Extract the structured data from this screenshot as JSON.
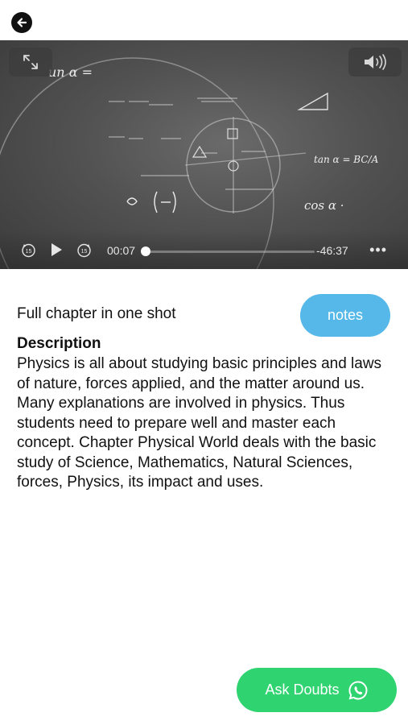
{
  "header": {
    "back_icon": "arrow-left-icon"
  },
  "video": {
    "fullscreen_icon": "expand-arrows-icon",
    "volume_icon": "speaker-volume-icon",
    "controls": {
      "rewind_icon": "rewind-15-icon",
      "rewind_label": "15",
      "play_icon": "play-icon",
      "forward_icon": "forward-15-icon",
      "forward_label": "15",
      "elapsed": "00:07",
      "remaining": "-46:37",
      "progress": 0.0,
      "more_icon": "more-dots-icon",
      "more_label": "•••"
    },
    "board_text": {
      "t1": "un α =",
      "t2": "tan α = BC/A",
      "t3": "cos α ·"
    }
  },
  "content": {
    "chapter_title": "Full chapter in one shot",
    "notes_label": "notes",
    "description_heading": "Description",
    "description_body": "Physics is all about studying basic principles and laws of nature, forces applied, and the matter around us. Many explanations are involved in physics. Thus students need to prepare well and master each concept. Chapter Physical World deals with the basic study of Science, Mathematics, Natural Sciences, forces, Physics, its impact and uses."
  },
  "footer": {
    "ask_label": "Ask Doubts",
    "ask_icon": "whatsapp-icon"
  },
  "colors": {
    "notes_button": "#55b8e8",
    "ask_button": "#2fd36f"
  }
}
